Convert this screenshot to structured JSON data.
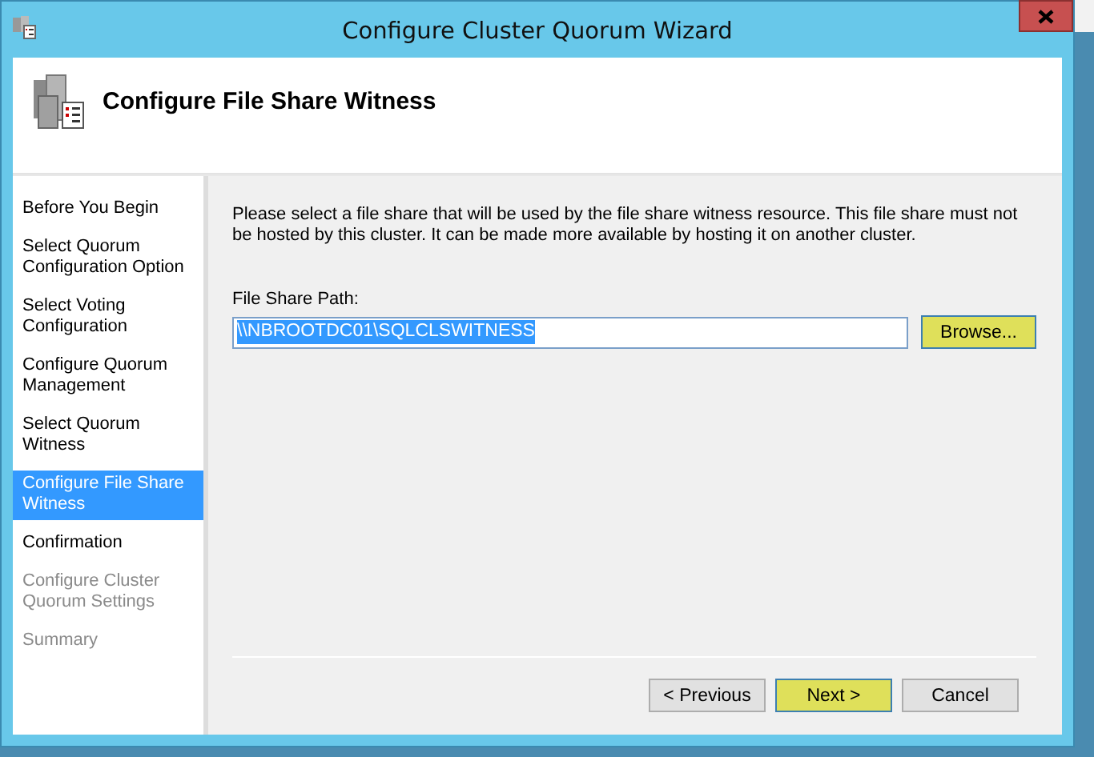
{
  "window": {
    "title": "Configure Cluster Quorum Wizard"
  },
  "header": {
    "title": "Configure File Share Witness"
  },
  "steps": [
    {
      "label": "Before You Begin",
      "selected": false,
      "disabled": false
    },
    {
      "label": "Select Quorum Configuration Option",
      "selected": false,
      "disabled": false
    },
    {
      "label": "Select Voting Configuration",
      "selected": false,
      "disabled": false
    },
    {
      "label": "Configure Quorum Management",
      "selected": false,
      "disabled": false
    },
    {
      "label": "Select Quorum Witness",
      "selected": false,
      "disabled": false
    },
    {
      "label": "Configure File Share Witness",
      "selected": true,
      "disabled": false
    },
    {
      "label": "Confirmation",
      "selected": false,
      "disabled": false
    },
    {
      "label": "Configure Cluster Quorum Settings",
      "selected": false,
      "disabled": true
    },
    {
      "label": "Summary",
      "selected": false,
      "disabled": true
    }
  ],
  "description": "Please select a file share that will be used by the file share witness resource.  This file share must not be hosted by this cluster.  It can be made more available by hosting it on another cluster.",
  "path_field": {
    "label": "File Share Path:",
    "value": "\\\\NBROOTDC01\\SQLCLSWITNESS"
  },
  "browse_button": {
    "label": "Browse...",
    "highlighted": true
  },
  "buttons": [
    {
      "label": "< Previous",
      "highlighted": false
    },
    {
      "label": "Next >",
      "highlighted": true
    },
    {
      "label": "Cancel",
      "highlighted": false
    }
  ]
}
